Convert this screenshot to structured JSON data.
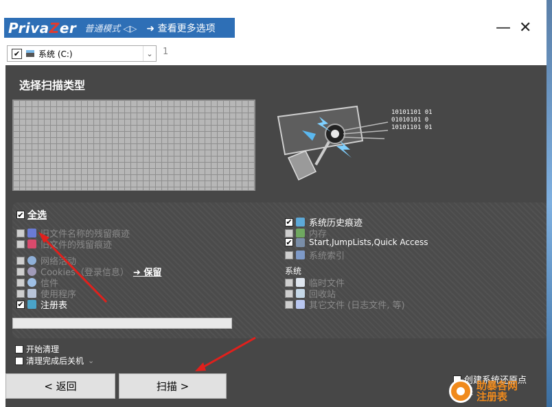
{
  "app": {
    "name_prefix": "Priva",
    "name_z": "Z",
    "name_suffix": "er",
    "mode": "普通模式 ◁▷",
    "more_options": "➜ 查看更多选项",
    "minimize": "—",
    "close": "✕"
  },
  "drive": {
    "checked": "✔",
    "label": "系统 (C:)",
    "dropdown": "⌄",
    "count": "1"
  },
  "main": {
    "title": "选择扫描类型",
    "binary": [
      "10101101 01",
      "01010101 0",
      "10101101 01"
    ]
  },
  "left_options": {
    "select_all": "全选",
    "items": [
      {
        "label": "旧文件名称的残留痕迹",
        "checked": false,
        "icon": "old-names-icon"
      },
      {
        "label": "旧文件的残留痕迹",
        "checked": false,
        "icon": "old-files-icon"
      },
      {
        "label": "网络活动",
        "checked": false,
        "icon": "network-icon"
      },
      {
        "label": "Cookies（登录信息）",
        "checked": false,
        "icon": "cookie-icon"
      },
      {
        "label": "信件",
        "checked": false,
        "icon": "mail-icon"
      },
      {
        "label": "使用程序",
        "checked": false,
        "icon": "programs-icon"
      },
      {
        "label": "注册表",
        "checked": true,
        "icon": "registry-icon"
      }
    ],
    "keep_link": "➜ 保留"
  },
  "right_options": {
    "items": [
      {
        "label": "系统历史痕迹",
        "checked": true,
        "icon": "history-icon"
      },
      {
        "label": "内存",
        "checked": false,
        "icon": "memory-icon"
      },
      {
        "label": "Start,JumpLists,Quick Access",
        "checked": true,
        "icon": "start-icon"
      },
      {
        "label": "系统索引",
        "checked": false,
        "icon": "index-icon"
      }
    ],
    "system_header": "系统",
    "system_items": [
      {
        "label": "临时文件",
        "checked": false,
        "icon": "temp-file-icon"
      },
      {
        "label": "回收站",
        "checked": false,
        "icon": "recycle-bin-icon"
      },
      {
        "label": "其它文件 (日志文件, 等)",
        "checked": false,
        "icon": "other-files-icon"
      }
    ]
  },
  "bottom": {
    "start_clean": "开始清理",
    "shutdown_after": "清理完成后关机",
    "shutdown_chevron": "⌄",
    "back_button": "< 返回",
    "scan_button": "扫描 >",
    "restore_point": "创建系统还原点",
    "backup_registry_a": "保",
    "backup_registry_b": "注册表"
  },
  "watermark": {
    "line1": "助暴各网",
    "line2": "注册表"
  },
  "colors": {
    "accent_blue": "#2e6fb6",
    "panel_dark": "#474747",
    "arrow_red": "#e1201c"
  }
}
